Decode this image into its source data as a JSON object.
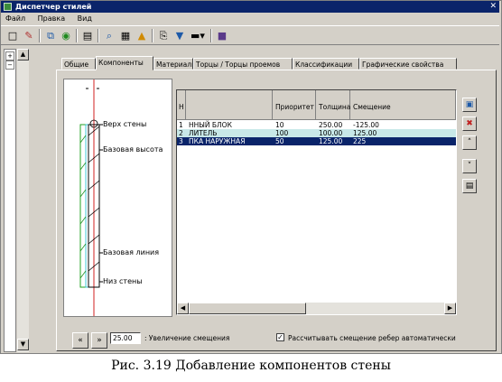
{
  "window": {
    "title": "Диспетчер стилей"
  },
  "menu": [
    "Файл",
    "Правка",
    "Вид"
  ],
  "tabs": [
    "Общие",
    "Компоненты",
    "Материалы",
    "Торцы / Торцы проемов",
    "Классификации",
    "Графические свойства"
  ],
  "preview": {
    "labels": [
      "Верх стены",
      "Базовая высота",
      "Базовая линия",
      "Низ стены"
    ]
  },
  "table": {
    "columns": [
      "Н",
      "",
      "Приоритет",
      "Толщина",
      "Смещение"
    ],
    "rows": [
      {
        "num": "1",
        "name": "ННЫЙ БЛОК",
        "priority": "10",
        "thickness": "250.00",
        "offset": "-125.00"
      },
      {
        "num": "2",
        "name": "ЛИТЕЛЬ",
        "priority": "100",
        "thickness": "100.00",
        "offset": "125.00"
      },
      {
        "num": "3",
        "name": "ПКА НАРУЖНАЯ",
        "priority": "50",
        "thickness": "125.00",
        "offset": "225"
      }
    ],
    "selected_row": 3
  },
  "bottom": {
    "prev_label": "«",
    "next_label": "»",
    "increment_value": "25.00",
    "increment_label": ": Увеличение смещения",
    "auto_checkbox_label": "Рассчитывать смещение ребер автоматически",
    "auto_checked": true
  },
  "caption": "Рис. 3.19 Добавление компонентов стены"
}
